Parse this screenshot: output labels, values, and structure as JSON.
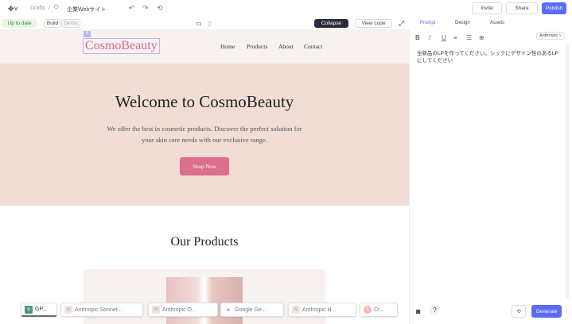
{
  "topbar": {
    "breadcrumb_root": "Drafts",
    "separator": "/",
    "project": "企業Webサイト",
    "invite": "Invite",
    "share": "Share",
    "publish": "Publish"
  },
  "toolbar": {
    "status": "Up to date",
    "mode_build": "Build",
    "mode_demo": "Demo",
    "collapse": "Collapse",
    "view_code": "View code"
  },
  "site": {
    "logo": "CosmoBeauty",
    "badge": "H",
    "nav": [
      "Home",
      "Products",
      "About",
      "Contact"
    ],
    "hero_title": "Welcome to CosmoBeauty",
    "hero_text_1": "We offer the best in cosmetic products. Discover the perfect solution for",
    "hero_text_2": "your skin care needs with our exclusive range.",
    "cta": "Shop Now",
    "products_title": "Our Products"
  },
  "panel": {
    "tabs": [
      "Prompt",
      "Design",
      "Assets"
    ],
    "format_buttons": [
      "B",
      "I",
      "U",
      "≡",
      "☰",
      "⊕"
    ],
    "model_select": "Anthropic",
    "prompt_text": "全新品のLPを作ってください。シックにデザイン性のあるLPにしてください",
    "generate": "Generate"
  },
  "models": [
    {
      "label": "GP...",
      "icon": "⚙"
    },
    {
      "label": "Anthropic Sonnet...",
      "icon": "AI"
    },
    {
      "label": "Anthropic O...",
      "icon": "AI"
    },
    {
      "label": "Google Ge...",
      "icon": "✦"
    },
    {
      "label": "Anthropic H...",
      "icon": "AI"
    },
    {
      "label": "Cr...",
      "icon": "S"
    }
  ],
  "colors": {
    "accent": "#5b6cf9",
    "cta": "#dd6e8c",
    "hero": "#f1ddd6"
  }
}
